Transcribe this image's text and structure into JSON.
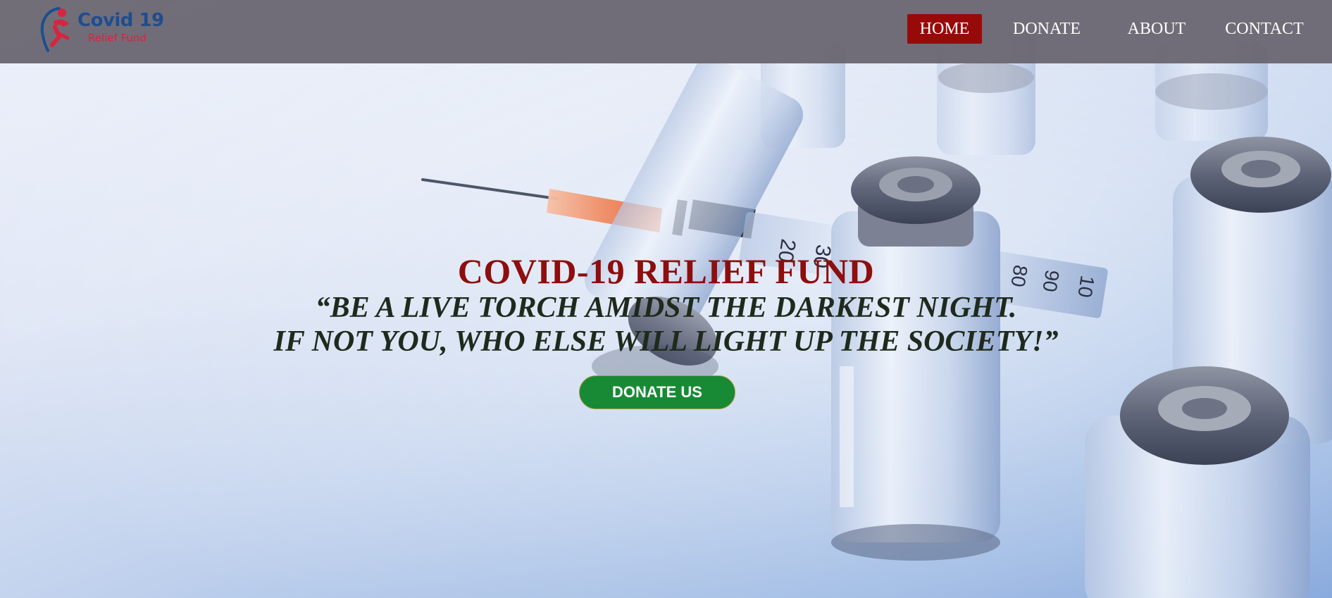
{
  "brand": {
    "title": "Covid 19",
    "subtitle": "Relief Fund",
    "logo_icon": "running-figure-logo-icon"
  },
  "nav": {
    "items": [
      {
        "label": "HOME",
        "active": true
      },
      {
        "label": "DONATE",
        "active": false
      },
      {
        "label": "ABOUT",
        "active": false
      },
      {
        "label": "CONTACT",
        "active": false
      }
    ]
  },
  "hero": {
    "title": "COVID-19 RELIEF FUND",
    "quote_line1": "“BE A LIVE TORCH AMIDST THE DARKEST NIGHT.",
    "quote_line2": "IF NOT YOU, WHO ELSE WILL LIGHT UP THE SOCIETY!”",
    "cta_label": "DONATE US",
    "syringe_markings": [
      "20",
      "30",
      "80",
      "90",
      "10"
    ]
  },
  "colors": {
    "header_bg": "#696570",
    "nav_active_bg": "#980a0a",
    "hero_title": "#8e0d0d",
    "cta_bg": "#188a35",
    "brand_title": "#1d4e8f",
    "brand_subtitle": "#d7243f"
  }
}
